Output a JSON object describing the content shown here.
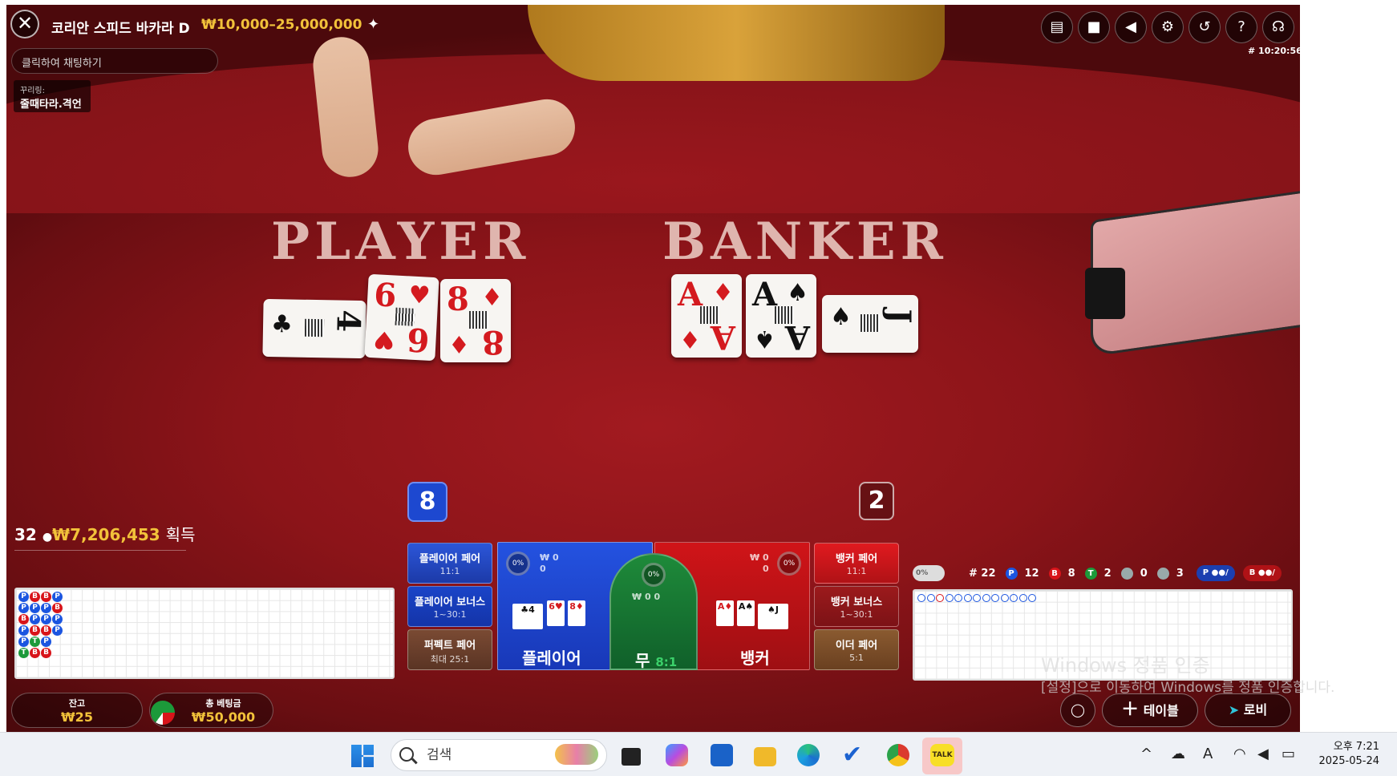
{
  "header": {
    "table_title": "코리안 스피드 바카라 D",
    "limit": "₩10,000–25,000,000",
    "chat_placeholder": "클릭하여 채팅하기",
    "deco_label": "꾸리링:",
    "deco_value": "줄때타라.격언",
    "time": "# 10:20:56"
  },
  "felt": {
    "player_word": "PLAYER",
    "banker_word": "BANKER"
  },
  "cards": {
    "player": [
      {
        "rank": "4",
        "suit": "♣",
        "color": "black",
        "rotated": true
      },
      {
        "rank": "6",
        "suit": "♥",
        "color": "red"
      },
      {
        "rank": "8",
        "suit": "♦",
        "color": "red"
      }
    ],
    "banker": [
      {
        "rank": "A",
        "suit": "♦",
        "color": "red"
      },
      {
        "rank": "A",
        "suit": "♠",
        "color": "black"
      },
      {
        "rank": "J",
        "suit": "♠",
        "color": "black",
        "rotated": true
      }
    ]
  },
  "scores": {
    "player": "8",
    "banker": "2"
  },
  "winners": {
    "count": "32",
    "amount": "₩7,206,453",
    "suffix": "획득"
  },
  "bets": {
    "player_pair": {
      "name": "플레이어 페어",
      "odds": "11:1"
    },
    "player_bonus": {
      "name": "플레이어 보너스",
      "odds": "1~30:1"
    },
    "perfect_pair": {
      "name": "퍼펙트 페어",
      "odds": "최대 25:1"
    },
    "banker_pair": {
      "name": "뱅커 페어",
      "odds": "11:1"
    },
    "banker_bonus": {
      "name": "뱅커 보너스",
      "odds": "1~30:1"
    },
    "either_pair": {
      "name": "이더 페어",
      "odds": "5:1"
    },
    "player_main": {
      "label": "플레이어",
      "pct": "0%",
      "won": "₩ 0",
      "people": "0"
    },
    "tie_main": {
      "label": "무",
      "odds": "8:1",
      "pct": "0%",
      "stat": "₩ 0  0"
    },
    "banker_main": {
      "label": "뱅커",
      "pct": "0%",
      "won": "₩ 0",
      "people": "0"
    }
  },
  "road": {
    "beads": [
      [
        "P",
        "B",
        "B",
        "P"
      ],
      [
        "P",
        "P",
        "P",
        "B"
      ],
      [
        "B",
        "P",
        "P",
        "P"
      ],
      [
        "P",
        "B",
        "B",
        "P"
      ],
      [
        "P",
        "T",
        "P"
      ],
      [
        "T",
        "B",
        "B"
      ]
    ],
    "big_road": [
      "P",
      "P",
      "B",
      "P",
      "P",
      "P",
      "P",
      "P",
      "P",
      "P",
      "P",
      "P",
      "P"
    ]
  },
  "stats": {
    "toggle": "0%",
    "rounds": "# 22",
    "player": "12",
    "banker": "8",
    "tie": "2",
    "p_pair": "0",
    "b_pair": "3",
    "p_pred": "P",
    "b_pred": "B"
  },
  "wallet": {
    "balance_label": "잔고",
    "balance": "₩25",
    "total_label": "총 베팅금",
    "total": "₩50,000"
  },
  "buttons": {
    "table": "테이블",
    "lobby": "로비"
  },
  "watermark": {
    "line1": "Windows 정품 인증",
    "line2": "[설정]으로 이동하여 Windows를 정품 인증합니다."
  },
  "taskbar": {
    "search": "검색",
    "time": "오후 7:21",
    "date": "2025-05-24"
  },
  "colors": {
    "player": "#1b55e0",
    "banker": "#d8141a",
    "tie": "#1c9a3a",
    "gold": "#f2c23a"
  }
}
